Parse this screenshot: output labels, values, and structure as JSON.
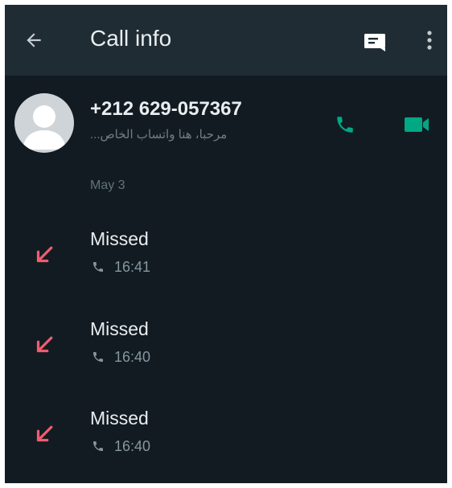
{
  "colors": {
    "app_bar": "#1f2c34",
    "background": "#121b22",
    "accent": "#00a884",
    "missed": "#f15c6d",
    "primary_text": "#e9edef",
    "secondary_text": "#8696a0"
  },
  "header": {
    "title": "Call info",
    "back_icon": "arrow-left-icon",
    "message_icon": "message-icon",
    "more_icon": "more-vert-icon"
  },
  "contact": {
    "phone_number": "+212 629-057367",
    "status": "مرحبا، هنا واتساب الخاص...",
    "avatar_icon": "default-avatar-icon",
    "voice_call_icon": "phone-icon",
    "video_call_icon": "video-icon"
  },
  "date_label": "May 3",
  "calls": [
    {
      "status": "Missed",
      "time": "16:41",
      "direction_icon": "missed-call-arrow-icon",
      "type_icon": "phone-icon"
    },
    {
      "status": "Missed",
      "time": "16:40",
      "direction_icon": "missed-call-arrow-icon",
      "type_icon": "phone-icon"
    },
    {
      "status": "Missed",
      "time": "16:40",
      "direction_icon": "missed-call-arrow-icon",
      "type_icon": "phone-icon"
    }
  ]
}
